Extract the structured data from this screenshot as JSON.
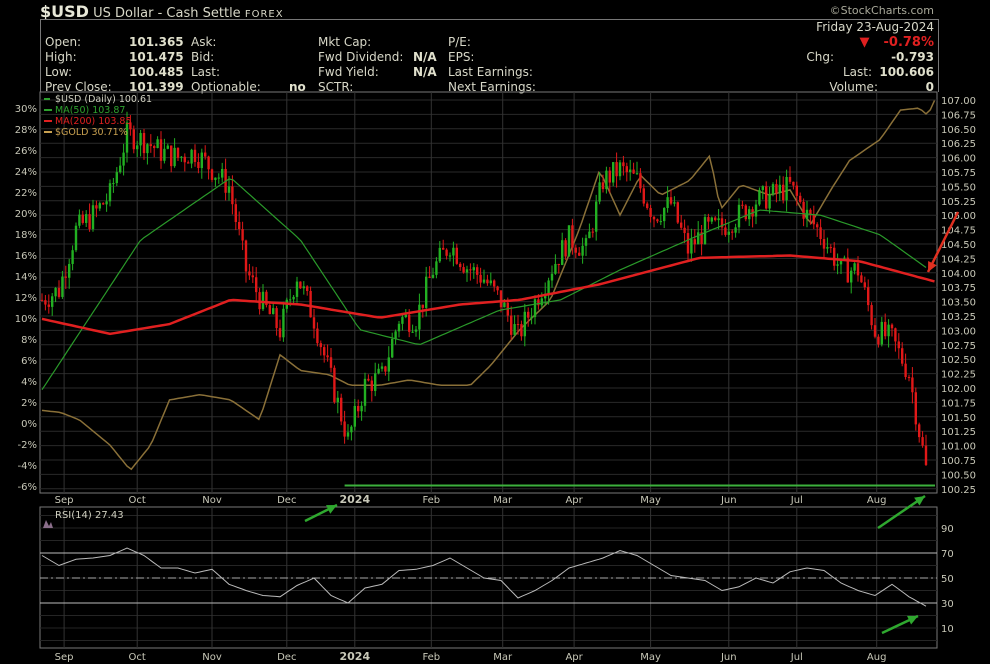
{
  "header": {
    "symbol": "$USD",
    "name": "US Dollar - Cash Settle",
    "exchange": "FOREX",
    "watermark": "©StockCharts.com",
    "date": "Friday  23-Aug-2024",
    "pct_change": "-0.78%",
    "chg_label": "Chg:",
    "chg": "-0.793",
    "last_label": "Last:",
    "last": "100.606",
    "volume_label": "Volume:",
    "volume": "0",
    "fields": [
      {
        "label": "Open:",
        "value": "101.365"
      },
      {
        "label": "High:",
        "value": "101.475"
      },
      {
        "label": "Low:",
        "value": "100.485"
      },
      {
        "label": "Prev Close:",
        "value": "101.399"
      },
      {
        "label": "Ask:",
        "value": ""
      },
      {
        "label": "Bid:",
        "value": ""
      },
      {
        "label": "Last:",
        "value": ""
      },
      {
        "label": "Optionable:",
        "value": "no"
      },
      {
        "label": "Mkt Cap:",
        "value": ""
      },
      {
        "label": "Fwd Dividend:",
        "value": "N/A"
      },
      {
        "label": "Fwd Yield:",
        "value": "N/A"
      },
      {
        "label": "SCTR:",
        "value": ""
      },
      {
        "label": "P/E:",
        "value": ""
      },
      {
        "label": "EPS:",
        "value": ""
      },
      {
        "label": "Last Earnings:",
        "value": ""
      },
      {
        "label": "Next Earnings:",
        "value": ""
      }
    ]
  },
  "chart_data": [
    {
      "type": "candlestick",
      "title": "$USD (Daily) 100.61",
      "legend": [
        {
          "name": "$USD (Daily) 100.61",
          "color": "#2ea12e"
        },
        {
          "name": "MA(50) 103.87",
          "color": "#2ea12e"
        },
        {
          "name": "MA(200) 103.85",
          "color": "#e02020"
        },
        {
          "name": "$GOLD 30.71%",
          "color": "#c8a050"
        }
      ],
      "x_ticks": [
        "Sep",
        "Oct",
        "Nov",
        "Dec",
        "2024",
        "Feb",
        "Mar",
        "Apr",
        "May",
        "Jun",
        "Jul",
        "Aug"
      ],
      "x_tick_weeks": [
        1.3,
        5.6,
        10,
        14.4,
        18.4,
        22.9,
        27.1,
        31.3,
        35.8,
        40.4,
        44.4,
        49.1
      ],
      "y_right_range": [
        100.25,
        107.0
      ],
      "y_right_step": 0.25,
      "y_left_range": [
        -6,
        30
      ],
      "y_left_step": 2,
      "weekly_close": [
        103.53,
        103.7,
        104.74,
        105.0,
        105.35,
        106.4,
        106.3,
        106.1,
        106.0,
        106.1,
        105.8,
        105.5,
        104.05,
        103.45,
        103.0,
        103.96,
        103.2,
        102.15,
        101.1,
        102.05,
        102.2,
        103.2,
        103.2,
        104.05,
        104.5,
        104.1,
        103.9,
        103.5,
        102.9,
        103.5,
        104.1,
        104.6,
        104.4,
        105.6,
        105.8,
        105.6,
        105.0,
        105.2,
        104.4,
        104.75,
        104.8,
        105.0,
        105.25,
        105.35,
        105.5,
        105.0,
        104.6,
        104.05,
        104.05,
        103.0,
        102.85,
        102.25,
        100.6
      ],
      "ma50": [
        [
          0,
          101.97
        ],
        [
          5.8,
          104.57
        ],
        [
          11.1,
          105.65
        ],
        [
          15.2,
          104.57
        ],
        [
          18.7,
          103.01
        ],
        [
          22.2,
          102.75
        ],
        [
          26.9,
          103.35
        ],
        [
          30.5,
          103.53
        ],
        [
          34,
          104.05
        ],
        [
          38.7,
          104.66
        ],
        [
          42.2,
          105.09
        ],
        [
          45.8,
          105.0
        ],
        [
          49.3,
          104.66
        ],
        [
          52.2,
          104.05
        ]
      ],
      "ma200": [
        [
          0,
          103.2
        ],
        [
          4,
          102.94
        ],
        [
          7.5,
          103.11
        ],
        [
          11.1,
          103.53
        ],
        [
          15.2,
          103.45
        ],
        [
          19.9,
          103.22
        ],
        [
          24.6,
          103.45
        ],
        [
          28.1,
          103.53
        ],
        [
          32.8,
          103.8
        ],
        [
          38.7,
          104.26
        ],
        [
          44,
          104.3
        ],
        [
          48.1,
          104.2
        ],
        [
          52.5,
          103.85
        ]
      ],
      "gold_pct": [
        [
          0,
          1.2
        ],
        [
          1.1,
          1.0
        ],
        [
          2.2,
          0.3
        ],
        [
          4,
          -2.1
        ],
        [
          5.2,
          -4.5
        ],
        [
          6.4,
          -2.1
        ],
        [
          7.5,
          2.2
        ],
        [
          9.3,
          2.7
        ],
        [
          11.1,
          2.2
        ],
        [
          12.8,
          0.3
        ],
        [
          14,
          6.5
        ],
        [
          15.2,
          5.0
        ],
        [
          16.9,
          4.6
        ],
        [
          18.1,
          3.6
        ],
        [
          19.9,
          3.6
        ],
        [
          21.6,
          4.1
        ],
        [
          23.4,
          3.6
        ],
        [
          25.2,
          3.6
        ],
        [
          26.4,
          5.5
        ],
        [
          28.1,
          8.9
        ],
        [
          29.9,
          11.7
        ],
        [
          31.6,
          18.4
        ],
        [
          32.8,
          24.1
        ],
        [
          34,
          19.8
        ],
        [
          35.2,
          23.6
        ],
        [
          36.4,
          21.7
        ],
        [
          38.1,
          23.1
        ],
        [
          39.3,
          25.5
        ],
        [
          39.9,
          20.3
        ],
        [
          41.1,
          22.7
        ],
        [
          42.8,
          21.7
        ],
        [
          44,
          22.2
        ],
        [
          45.2,
          18.9
        ],
        [
          46.4,
          22.2
        ],
        [
          47.5,
          25.0
        ],
        [
          49.3,
          27.0
        ],
        [
          50.5,
          29.8
        ],
        [
          51.6,
          30.0
        ],
        [
          52.1,
          29.3
        ],
        [
          52.5,
          30.71
        ]
      ],
      "support_level": 100.48
    },
    {
      "type": "line",
      "title": "RSI(14) 27.43",
      "y_range": [
        0,
        100
      ],
      "y_ticks": [
        90,
        70,
        50,
        30,
        10
      ],
      "x_ticks": [
        "Sep",
        "Oct",
        "Nov",
        "Dec",
        "2024",
        "Feb",
        "Mar",
        "Apr",
        "May",
        "Jun",
        "Jul",
        "Aug"
      ],
      "weekly_rsi": [
        68,
        60,
        65,
        66,
        68,
        74,
        68,
        58,
        58,
        54,
        57,
        45,
        40,
        36,
        35,
        44,
        50,
        36,
        30,
        42,
        45,
        56,
        57,
        60,
        66,
        58,
        50,
        48,
        34,
        40,
        48,
        58,
        62,
        66,
        72,
        68,
        60,
        52,
        50,
        48,
        40,
        43,
        50,
        46,
        55,
        58,
        56,
        46,
        40,
        36,
        45,
        35,
        27.43
      ]
    }
  ]
}
